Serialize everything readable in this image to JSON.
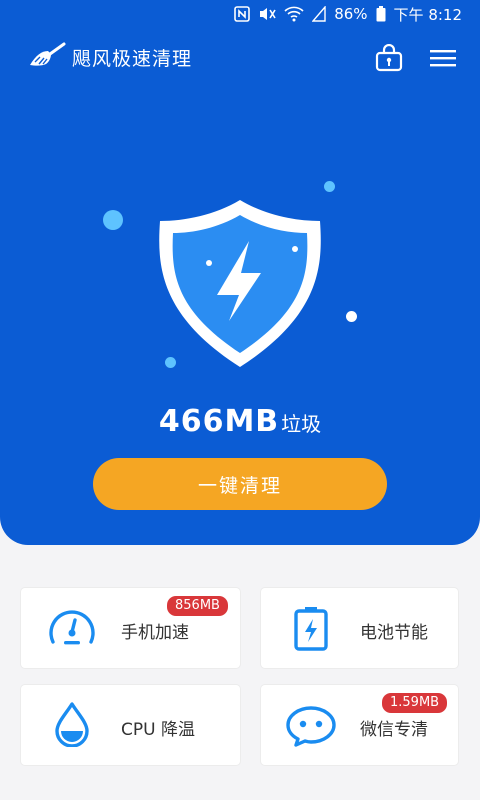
{
  "status_bar": {
    "battery": "86%",
    "time": "下午 8:12"
  },
  "app": {
    "title": "飓风极速清理"
  },
  "junk": {
    "amount": "466MB",
    "unit": "垃圾"
  },
  "clean_button": "一键清理",
  "features": [
    {
      "label": "手机加速",
      "badge": "856MB",
      "icon": "speedometer-icon"
    },
    {
      "label": "电池节能",
      "badge": "",
      "icon": "battery-icon"
    },
    {
      "label": "CPU 降温",
      "badge": "",
      "icon": "water-drop-icon"
    },
    {
      "label": "微信专清",
      "badge": "1.59MB",
      "icon": "chat-bubble-icon"
    }
  ],
  "colors": {
    "primary": "#0b5cd4",
    "accent_orange": "#f5a623",
    "icon_blue": "#1a8cf0",
    "badge_red": "#d9373a"
  }
}
